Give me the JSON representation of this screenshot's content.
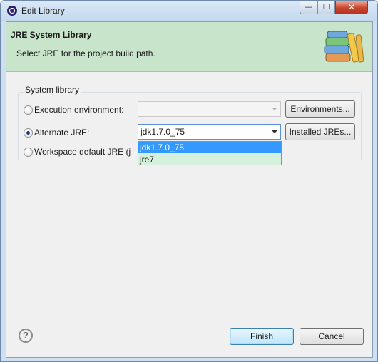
{
  "window": {
    "title": "Edit Library",
    "controls": {
      "minimize": "—",
      "maximize": "☐",
      "close": "✕"
    }
  },
  "header": {
    "title": "JRE System Library",
    "subtitle": "Select JRE for the project build path.",
    "icon": "library-books-icon"
  },
  "group": {
    "legend": "System library",
    "options": [
      {
        "label": "Execution environment:",
        "checked": false,
        "combo_value": "",
        "combo_enabled": false,
        "button": "Environments..."
      },
      {
        "label": "Alternate JRE:",
        "checked": true,
        "combo_value": "jdk1.7.0_75",
        "combo_enabled": true,
        "button": "Installed JREs..."
      },
      {
        "label": "Workspace default JRE (j",
        "checked": false
      }
    ]
  },
  "dropdown": {
    "items": [
      "jdk1.7.0_75",
      "jre7"
    ],
    "selected": "jdk1.7.0_75"
  },
  "footer": {
    "help": "?",
    "finish": "Finish",
    "cancel": "Cancel"
  },
  "colors": {
    "header_bg": "#c8e4cb",
    "dropdown_bg": "#d6f0de",
    "selection": "#3399ff",
    "close_button": "#c8432c"
  }
}
